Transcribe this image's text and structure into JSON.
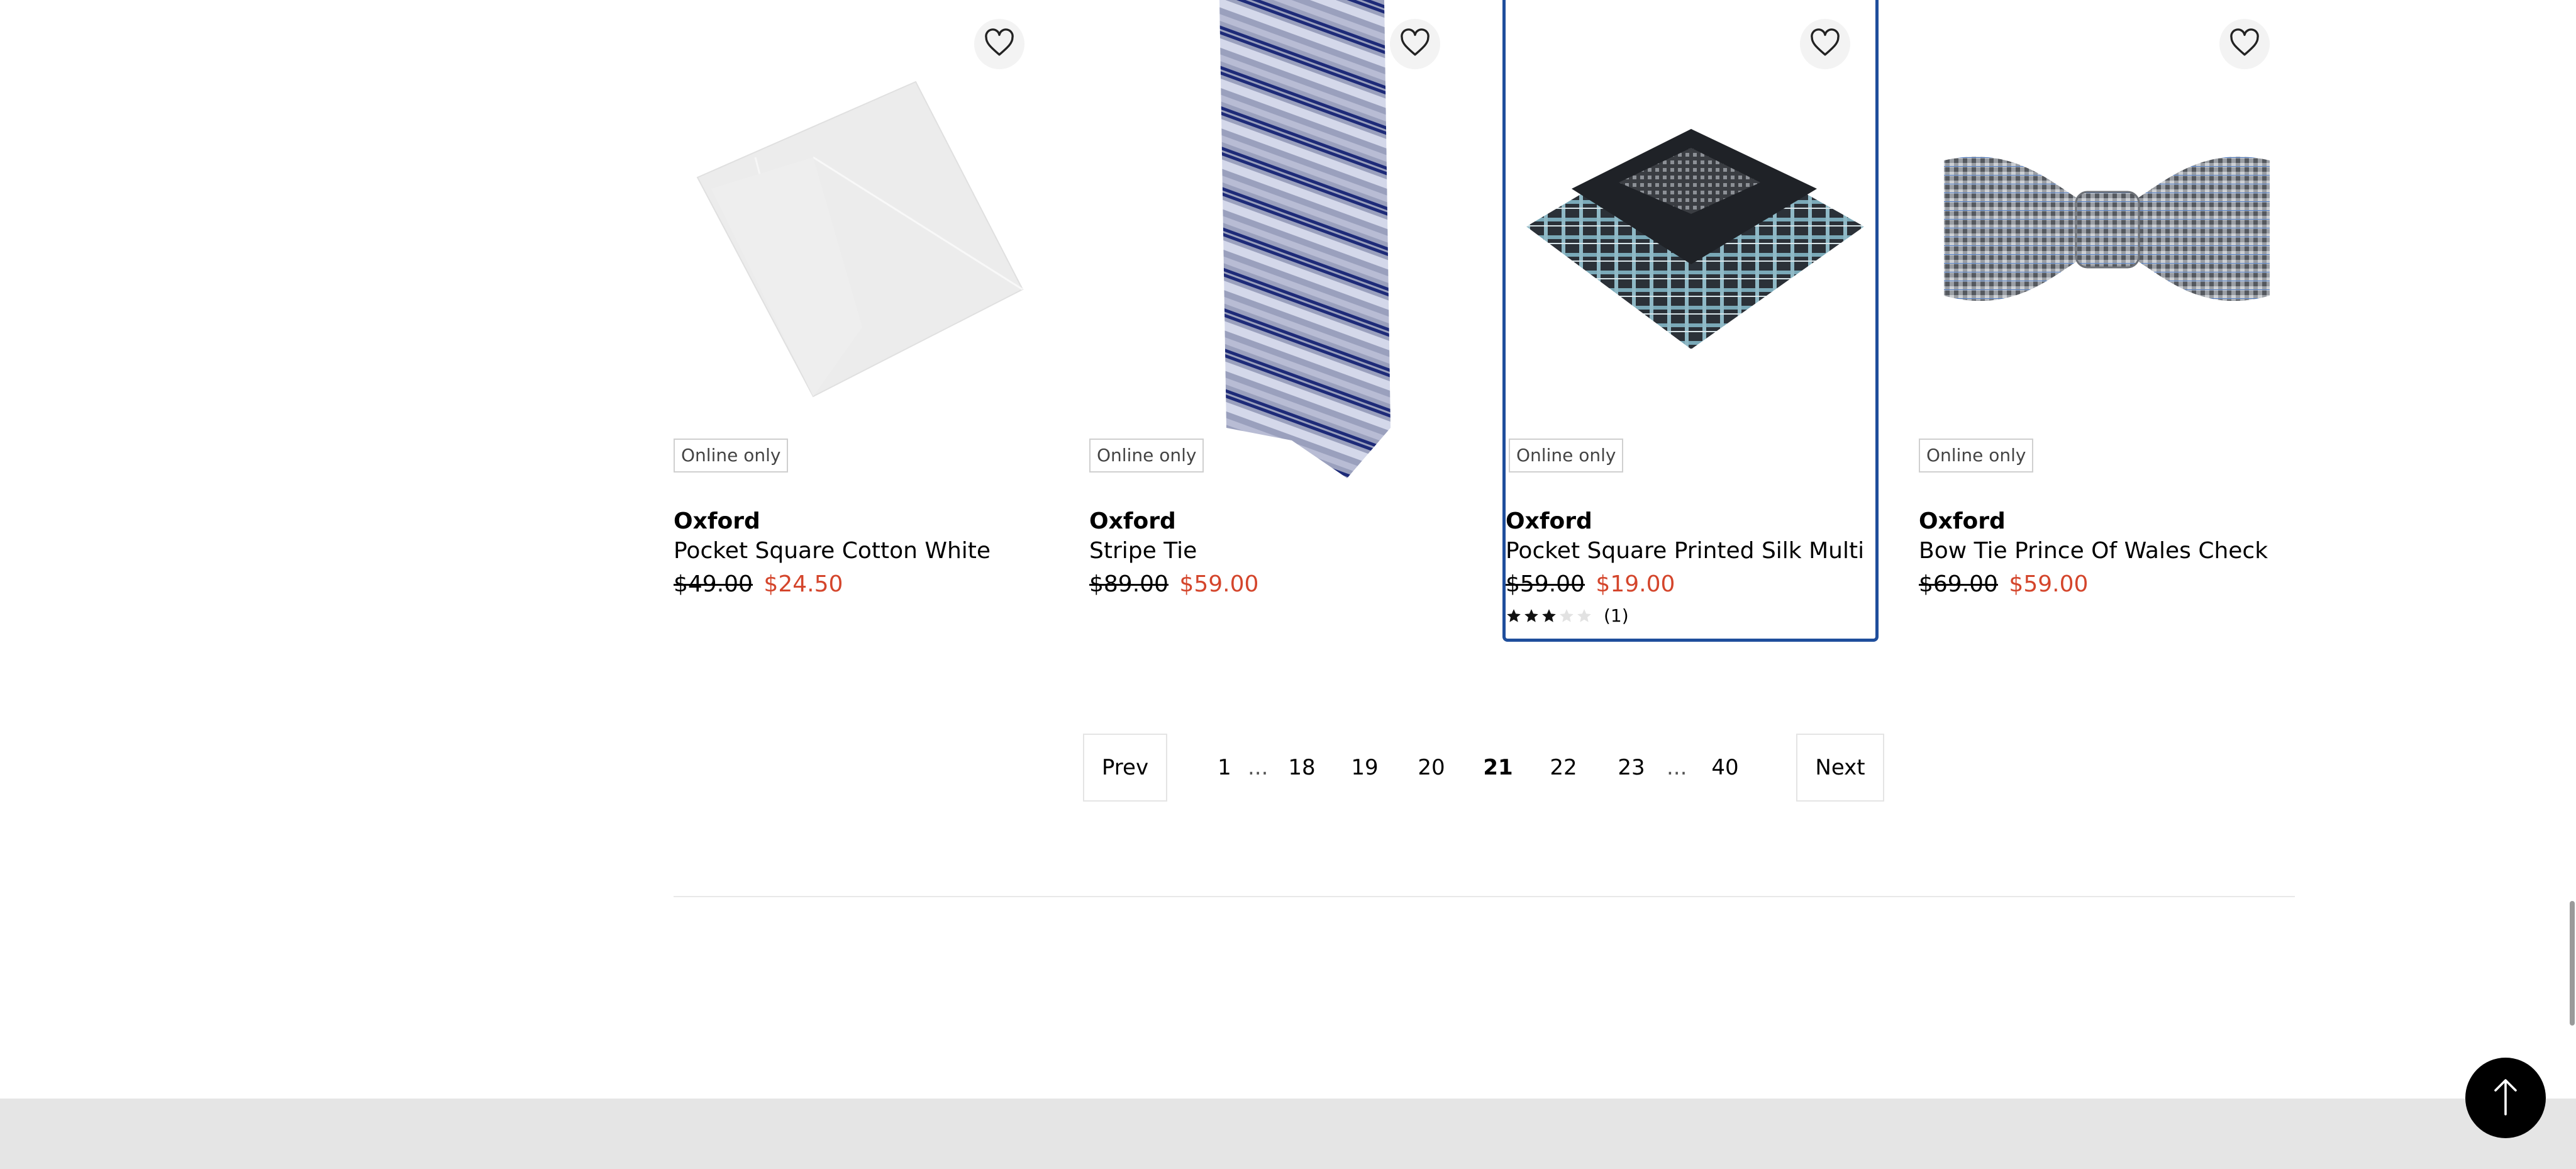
{
  "products": [
    {
      "badge": "Online only",
      "brand": "Oxford",
      "name": "Pocket Square Cotton White",
      "old_price": "$49.00",
      "new_price": "$24.50"
    },
    {
      "badge": "Online only",
      "brand": "Oxford",
      "name": "Stripe Tie",
      "old_price": "$89.00",
      "new_price": "$59.00"
    },
    {
      "badge": "Online only",
      "brand": "Oxford",
      "name": "Pocket Square Printed Silk Multi",
      "old_price": "$59.00",
      "new_price": "$19.00",
      "rating": 3,
      "rating_max": 5,
      "review_count": "(1)"
    },
    {
      "badge": "Online only",
      "brand": "Oxford",
      "name": "Bow Tie Prince Of Wales Check",
      "old_price": "$69.00",
      "new_price": "$59.00"
    }
  ],
  "pagination": {
    "prev": "Prev",
    "next": "Next",
    "ellipsis": "...",
    "pages": [
      "1",
      "18",
      "19",
      "20",
      "21",
      "22",
      "23",
      "40"
    ],
    "current": "21"
  },
  "icons": {
    "favorite": "heart-outline-icon",
    "back_to_top": "arrow-up-icon",
    "star": "star-icon"
  },
  "colors": {
    "sale_price": "#d4452b",
    "selected_border": "#1f4e9c",
    "footer_bg": "#e5e5e5"
  }
}
